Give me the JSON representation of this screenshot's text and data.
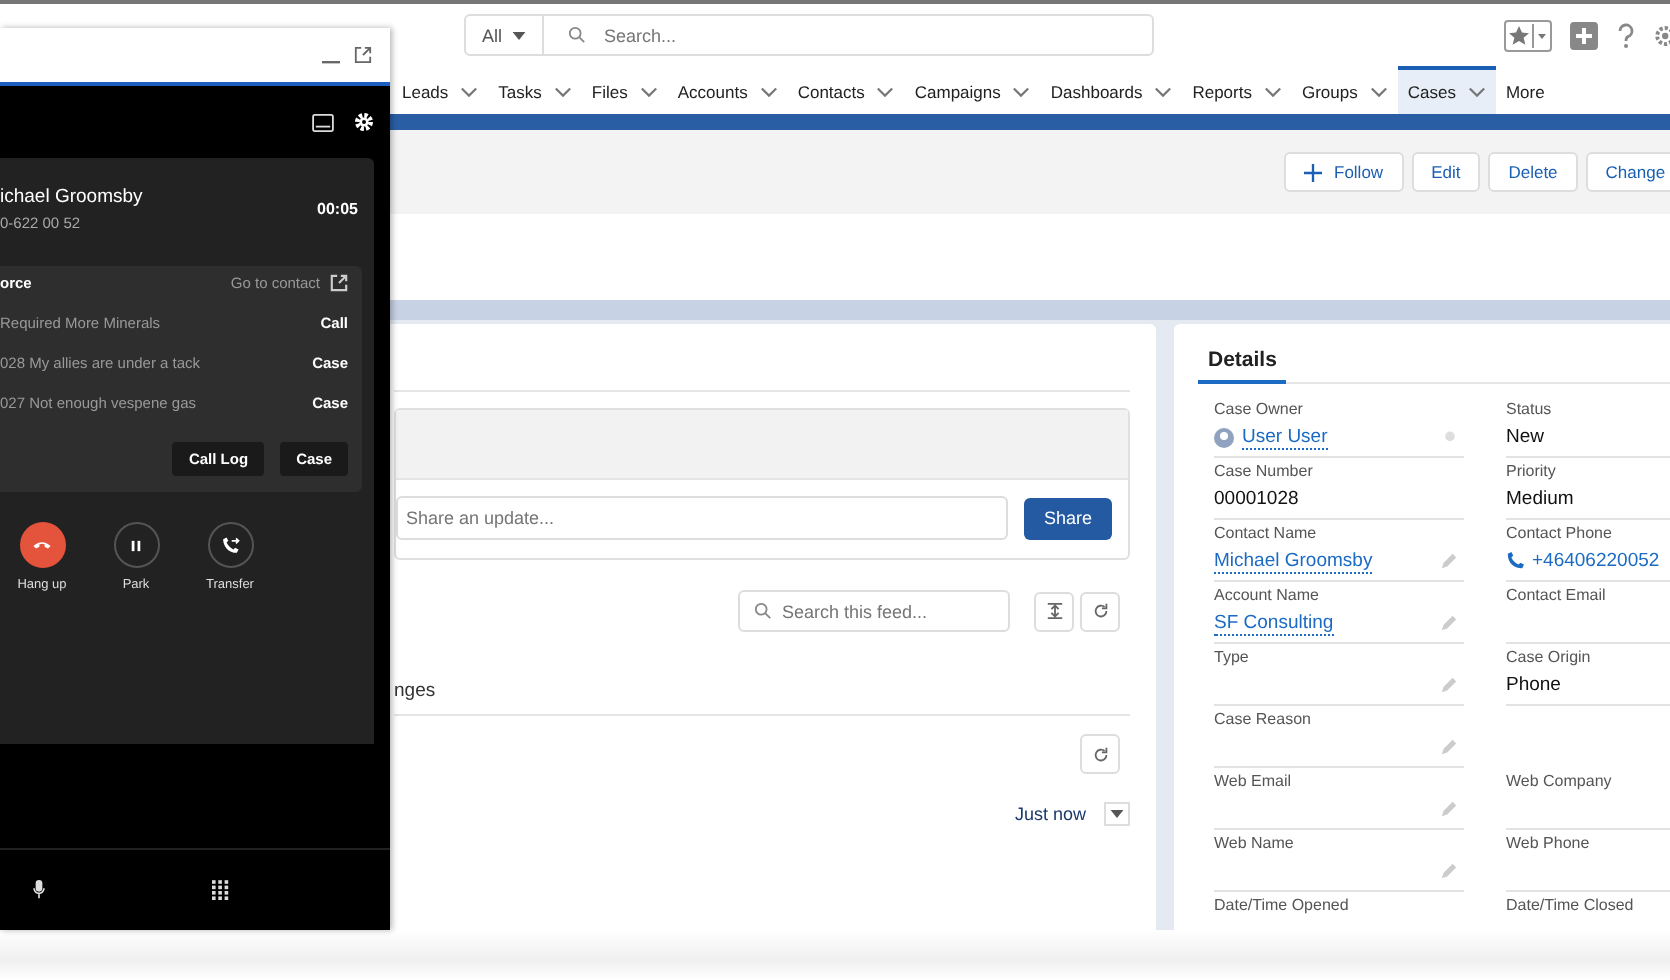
{
  "header": {
    "scope": "All",
    "search_placeholder": "Search..."
  },
  "nav": {
    "items": [
      {
        "label": "Leads",
        "selected": false
      },
      {
        "label": "Tasks",
        "selected": false
      },
      {
        "label": "Files",
        "selected": false
      },
      {
        "label": "Accounts",
        "selected": false
      },
      {
        "label": "Contacts",
        "selected": false
      },
      {
        "label": "Campaigns",
        "selected": false
      },
      {
        "label": "Dashboards",
        "selected": false
      },
      {
        "label": "Reports",
        "selected": false
      },
      {
        "label": "Groups",
        "selected": false
      },
      {
        "label": "Cases",
        "selected": true
      },
      {
        "label": "More",
        "selected": false
      }
    ]
  },
  "actions": [
    {
      "label": "Follow",
      "kind": "add"
    },
    {
      "label": "Edit",
      "kind": "plain"
    },
    {
      "label": "Delete",
      "kind": "plain"
    },
    {
      "label": "Change",
      "kind": "plain"
    }
  ],
  "feed": {
    "share_placeholder": "Share an update...",
    "share_button": "Share",
    "search_placeholder": "Search this feed...",
    "filter_label": "nges",
    "time": "Just now"
  },
  "details": {
    "tab": "Details",
    "rows": [
      {
        "left": {
          "label": "Case Owner",
          "value": "User User",
          "kind": "owner",
          "editable": false
        },
        "right": {
          "label": "Status",
          "value": "New",
          "kind": "text"
        }
      },
      {
        "left": {
          "label": "Case Number",
          "value": "00001028",
          "kind": "text",
          "editable": false
        },
        "right": {
          "label": "Priority",
          "value": "Medium",
          "kind": "text"
        }
      },
      {
        "left": {
          "label": "Contact Name",
          "value": "Michael Groomsby",
          "kind": "link",
          "editable": true
        },
        "right": {
          "label": "Contact Phone",
          "value": "+46406220052",
          "kind": "phone"
        }
      },
      {
        "left": {
          "label": "Account Name",
          "value": "SF Consulting",
          "kind": "link",
          "editable": true
        },
        "right": {
          "label": "Contact Email",
          "kind": "text"
        }
      },
      {
        "left": {
          "label": "Type",
          "kind": "text",
          "editable": true
        },
        "right": {
          "label": "Case Origin",
          "value": "Phone",
          "kind": "text"
        }
      },
      {
        "left": {
          "label": "Case Reason",
          "kind": "text",
          "editable": true
        }
      },
      {
        "left": {
          "label": "Web Email",
          "kind": "text",
          "editable": true
        },
        "right": {
          "label": "Web Company",
          "kind": "text"
        }
      },
      {
        "left": {
          "label": "Web Name",
          "kind": "text",
          "editable": true
        },
        "right": {
          "label": "Web Phone",
          "kind": "text"
        }
      },
      {
        "left": {
          "label": "Date/Time Opened",
          "kind": "text",
          "editable": false
        },
        "right": {
          "label": "Date/Time Closed",
          "kind": "text"
        }
      }
    ]
  },
  "phone": {
    "caller": "ichael Groomsby",
    "number": "0-622 00 52",
    "timer": "00:05",
    "crm": {
      "title": "orce",
      "link": "Go to contact",
      "records": [
        {
          "text": "Required More Minerals",
          "type": "Call"
        },
        {
          "text": "028 My allies are under a tack",
          "type": "Case"
        },
        {
          "text": "027 Not enough vespene gas",
          "type": "Case"
        }
      ],
      "buttons": [
        "Call Log",
        "Case"
      ]
    },
    "controls": [
      {
        "label": "Hang up",
        "kind": "hangup"
      },
      {
        "label": "Park",
        "kind": "park"
      },
      {
        "label": "Transfer",
        "kind": "transfer"
      }
    ]
  }
}
